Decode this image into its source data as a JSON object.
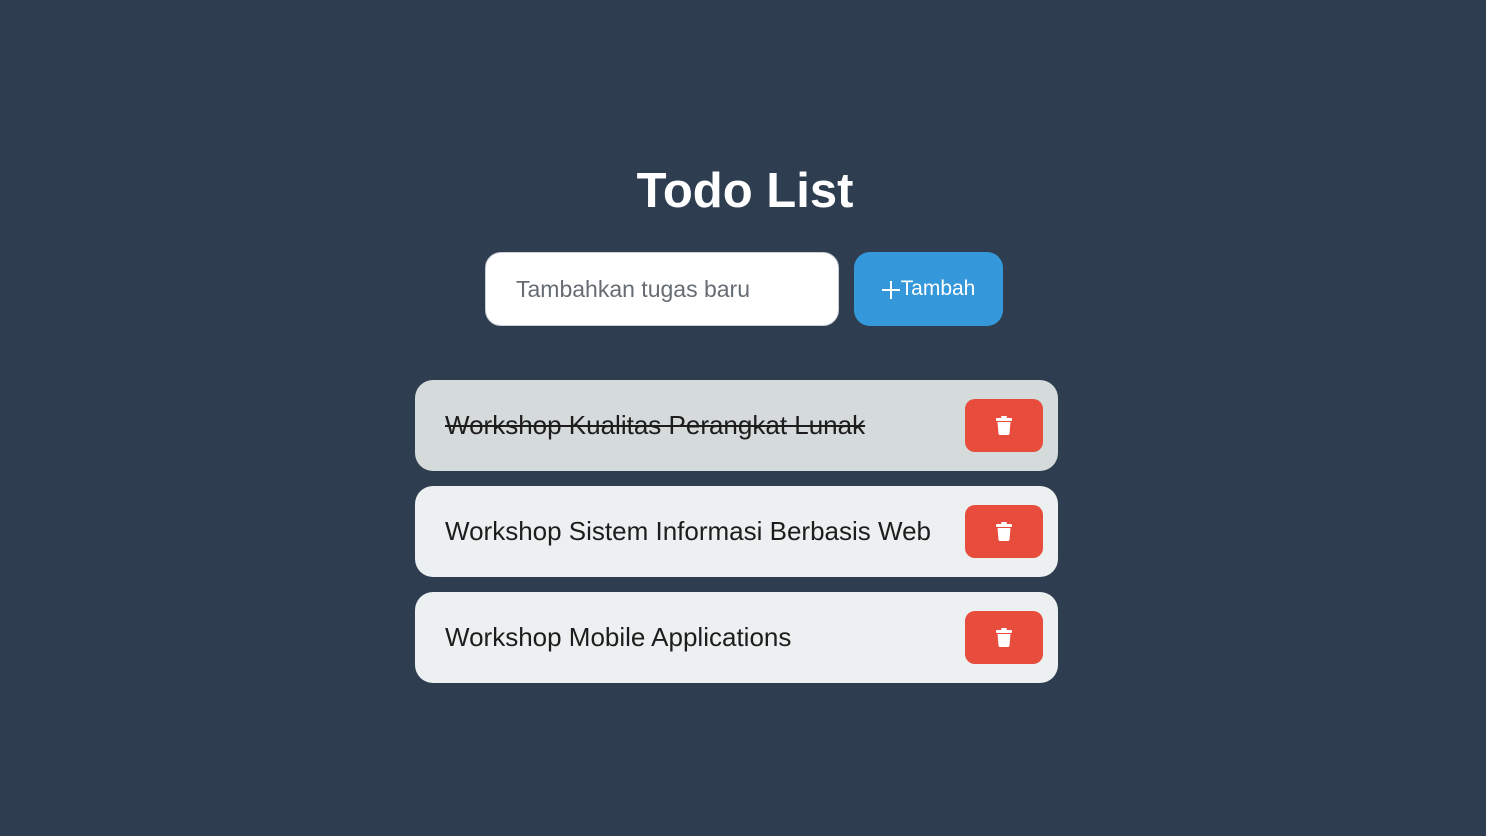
{
  "header": {
    "title": "Todo List"
  },
  "new_task": {
    "placeholder": "Tambahkan tugas baru",
    "value": "",
    "add_button_label": "Tambah",
    "add_icon": "plus-icon"
  },
  "colors": {
    "background": "#2e3e50",
    "accent": "#3498db",
    "danger": "#e74c3c",
    "item_background": "#ecf0f1",
    "item_done_background": "#d5dadb"
  },
  "todos": [
    {
      "text": "Workshop Kualitas Perangkat Lunak",
      "completed": true,
      "delete_icon": "trash-icon"
    },
    {
      "text": "Workshop Sistem Informasi Berbasis Web",
      "completed": false,
      "delete_icon": "trash-icon"
    },
    {
      "text": "Workshop Mobile Applications",
      "completed": false,
      "delete_icon": "trash-icon"
    }
  ]
}
